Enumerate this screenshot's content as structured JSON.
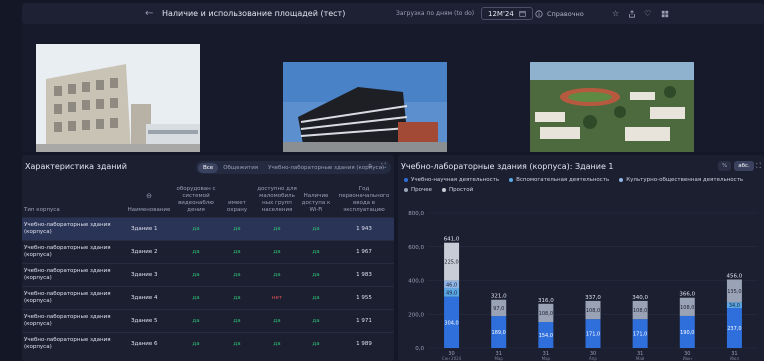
{
  "topbar": {
    "back_glyph": "←",
    "title": "Наличие и использование площадей (тест)",
    "load_label": "Загрузка по дням (to do)",
    "period": "12M'24",
    "help": "Справочно",
    "icons": [
      "star-icon",
      "share-icon",
      "heart-icon",
      "grid-icon"
    ]
  },
  "buildings_panel": {
    "title": "Характеристика зданий",
    "filters": [
      "Все",
      "Общежития",
      "Учебно-лабораторные здания (корпуса)"
    ],
    "active_filter": "Все",
    "sort_glyph": "⊖",
    "columns": [
      "Тип корпуса",
      "Наименование",
      "оборудован с системой видеонаблю дения",
      "имеет охрану",
      "доступно для маломобиль ных групп населения",
      "Наличие доступа к Wi-Fi",
      "Год первоначального ввода в эксплуатацию"
    ],
    "rows": [
      {
        "type": "Учебно-лабораторные здания (корпуса)",
        "name": "Здание 1",
        "video": "да",
        "guard": "да",
        "access": "да",
        "wifi": "да",
        "year": "1 943",
        "selected": true
      },
      {
        "type": "Учебно-лабораторные здания (корпуса)",
        "name": "Здание 2",
        "video": "да",
        "guard": "да",
        "access": "да",
        "wifi": "да",
        "year": "1 967",
        "selected": false
      },
      {
        "type": "Учебно-лабораторные здания (корпуса)",
        "name": "Здание 3",
        "video": "да",
        "guard": "да",
        "access": "да",
        "wifi": "да",
        "year": "1 983",
        "selected": false
      },
      {
        "type": "Учебно-лабораторные здания (корпуса)",
        "name": "Здание 4",
        "video": "да",
        "guard": "да",
        "access": "нет",
        "wifi": "да",
        "year": "1 955",
        "selected": false
      },
      {
        "type": "Учебно-лабораторные здания (корпуса)",
        "name": "Здание 5",
        "video": "да",
        "guard": "да",
        "access": "да",
        "wifi": "да",
        "year": "1 971",
        "selected": false
      },
      {
        "type": "Учебно-лабораторные здания (корпуса)",
        "name": "Здание 6",
        "video": "да",
        "guard": "да",
        "access": "да",
        "wifi": "да",
        "year": "1 989",
        "selected": false
      }
    ]
  },
  "chart_panel": {
    "title": "Учебно-лабораторные здания (корпуса): Здание 1",
    "toggle": [
      "%",
      "абс."
    ],
    "active_toggle": "абс."
  },
  "chart_data": {
    "type": "bar",
    "stacked": true,
    "ylim": [
      0,
      800
    ],
    "yticks": [
      "0,0",
      "200,0",
      "400,0",
      "600,0",
      "800,0"
    ],
    "categories": [
      "30",
      "31",
      "31",
      "30",
      "31",
      "30",
      "31"
    ],
    "category_sublabels": [
      "Сен 2024",
      "Мар",
      "Мар",
      "Апр",
      "Май",
      "Июн",
      "Июл"
    ],
    "series": [
      {
        "name": "Учебно-научная деятельность",
        "color": "#2f6fdc",
        "values": [
          304,
          189,
          154,
          171,
          171,
          190,
          237
        ]
      },
      {
        "name": "Вспомогательная деятельность",
        "color": "#5aa8e6",
        "values": [
          49,
          0,
          0,
          0,
          0,
          0,
          34
        ]
      },
      {
        "name": "Культурно-общественная деятельность",
        "color": "#8fb6e6",
        "values": [
          46,
          0,
          0,
          0,
          0,
          0,
          0
        ]
      },
      {
        "name": "Прочее",
        "color": "#9aa3b5",
        "values": [
          0,
          97,
          108,
          108,
          108,
          108,
          135
        ]
      },
      {
        "name": "Простой",
        "color": "#c8ccd6",
        "values": [
          225,
          0,
          0,
          0,
          0,
          0,
          0
        ]
      }
    ],
    "data_labels": {
      "totals": [
        "641,0",
        "321,0",
        "316,0",
        "337,0",
        "340,0",
        "366,0",
        "456,0"
      ],
      "segments": [
        [
          "304,0",
          "49,0",
          "46,0",
          "",
          "225,0"
        ],
        [
          "189,0",
          "",
          "",
          "97,0",
          ""
        ],
        [
          "154,0",
          "",
          "",
          "108,0",
          ""
        ],
        [
          "171,0",
          "",
          "",
          "108,0",
          ""
        ],
        [
          "171,0",
          "",
          "",
          "108,0",
          ""
        ],
        [
          "190,0",
          "",
          "",
          "108,0",
          ""
        ],
        [
          "237,0",
          "34,0",
          "",
          "135,0",
          ""
        ]
      ]
    },
    "legend": "top"
  }
}
